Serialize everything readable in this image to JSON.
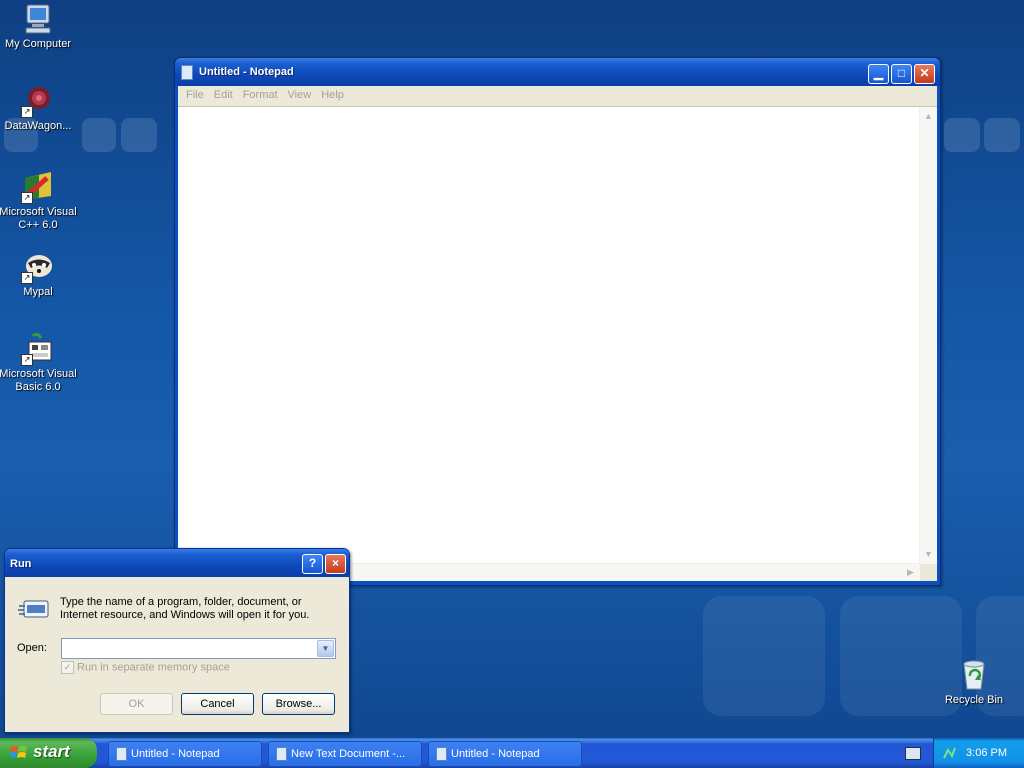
{
  "desktop": {
    "icons": [
      {
        "label": "My Computer",
        "icon": "computer-icon"
      },
      {
        "label": "DataWagon...",
        "icon": "datawagon-icon"
      },
      {
        "label": "Microsoft Visual C++ 6.0",
        "icon": "visual-cpp-icon"
      },
      {
        "label": "Mypal",
        "icon": "mypal-icon"
      },
      {
        "label": "Microsoft Visual Basic 6.0",
        "icon": "visual-basic-icon"
      },
      {
        "label": "Recycle Bin",
        "icon": "recycle-bin-icon"
      }
    ]
  },
  "notepad": {
    "title": "Untitled - Notepad",
    "menu": [
      "File",
      "Edit",
      "Format",
      "View",
      "Help"
    ],
    "content": ""
  },
  "run_dialog": {
    "title": "Run",
    "description": "Type the name of a program, folder, document, or Internet resource, and Windows will open it for you.",
    "open_label": "Open:",
    "open_value": "",
    "checkbox_label": "Run in separate memory space",
    "checkbox_checked": true,
    "ok_label": "OK",
    "cancel_label": "Cancel",
    "browse_label": "Browse...",
    "help_symbol": "?",
    "close_symbol": "×"
  },
  "taskbar": {
    "start_label": "start",
    "tasks": [
      {
        "label": "Untitled - Notepad",
        "active": false
      },
      {
        "label": "New Text Document -...",
        "active": false
      },
      {
        "label": "Untitled - Notepad",
        "active": false
      }
    ],
    "clock": "3:06 PM"
  },
  "colors": {
    "title_blue": "#0a3ea9",
    "start_green": "#37a137",
    "desktop_blue": "#1457a6"
  }
}
